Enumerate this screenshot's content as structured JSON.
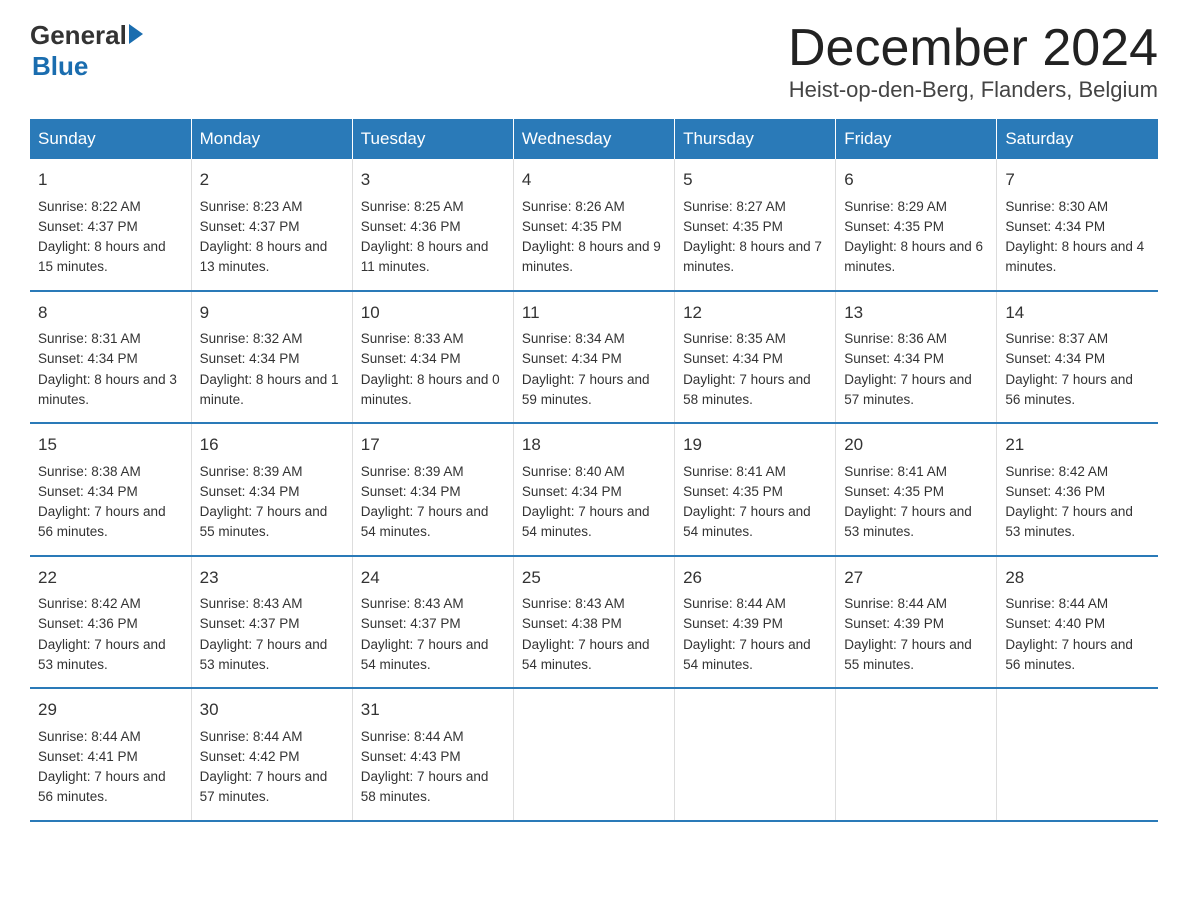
{
  "header": {
    "logo_general": "General",
    "logo_blue": "Blue",
    "month": "December 2024",
    "location": "Heist-op-den-Berg, Flanders, Belgium"
  },
  "weekdays": [
    "Sunday",
    "Monday",
    "Tuesday",
    "Wednesday",
    "Thursday",
    "Friday",
    "Saturday"
  ],
  "weeks": [
    [
      {
        "day": "1",
        "sunrise": "8:22 AM",
        "sunset": "4:37 PM",
        "daylight": "8 hours and 15 minutes."
      },
      {
        "day": "2",
        "sunrise": "8:23 AM",
        "sunset": "4:37 PM",
        "daylight": "8 hours and 13 minutes."
      },
      {
        "day": "3",
        "sunrise": "8:25 AM",
        "sunset": "4:36 PM",
        "daylight": "8 hours and 11 minutes."
      },
      {
        "day": "4",
        "sunrise": "8:26 AM",
        "sunset": "4:35 PM",
        "daylight": "8 hours and 9 minutes."
      },
      {
        "day": "5",
        "sunrise": "8:27 AM",
        "sunset": "4:35 PM",
        "daylight": "8 hours and 7 minutes."
      },
      {
        "day": "6",
        "sunrise": "8:29 AM",
        "sunset": "4:35 PM",
        "daylight": "8 hours and 6 minutes."
      },
      {
        "day": "7",
        "sunrise": "8:30 AM",
        "sunset": "4:34 PM",
        "daylight": "8 hours and 4 minutes."
      }
    ],
    [
      {
        "day": "8",
        "sunrise": "8:31 AM",
        "sunset": "4:34 PM",
        "daylight": "8 hours and 3 minutes."
      },
      {
        "day": "9",
        "sunrise": "8:32 AM",
        "sunset": "4:34 PM",
        "daylight": "8 hours and 1 minute."
      },
      {
        "day": "10",
        "sunrise": "8:33 AM",
        "sunset": "4:34 PM",
        "daylight": "8 hours and 0 minutes."
      },
      {
        "day": "11",
        "sunrise": "8:34 AM",
        "sunset": "4:34 PM",
        "daylight": "7 hours and 59 minutes."
      },
      {
        "day": "12",
        "sunrise": "8:35 AM",
        "sunset": "4:34 PM",
        "daylight": "7 hours and 58 minutes."
      },
      {
        "day": "13",
        "sunrise": "8:36 AM",
        "sunset": "4:34 PM",
        "daylight": "7 hours and 57 minutes."
      },
      {
        "day": "14",
        "sunrise": "8:37 AM",
        "sunset": "4:34 PM",
        "daylight": "7 hours and 56 minutes."
      }
    ],
    [
      {
        "day": "15",
        "sunrise": "8:38 AM",
        "sunset": "4:34 PM",
        "daylight": "7 hours and 56 minutes."
      },
      {
        "day": "16",
        "sunrise": "8:39 AM",
        "sunset": "4:34 PM",
        "daylight": "7 hours and 55 minutes."
      },
      {
        "day": "17",
        "sunrise": "8:39 AM",
        "sunset": "4:34 PM",
        "daylight": "7 hours and 54 minutes."
      },
      {
        "day": "18",
        "sunrise": "8:40 AM",
        "sunset": "4:34 PM",
        "daylight": "7 hours and 54 minutes."
      },
      {
        "day": "19",
        "sunrise": "8:41 AM",
        "sunset": "4:35 PM",
        "daylight": "7 hours and 54 minutes."
      },
      {
        "day": "20",
        "sunrise": "8:41 AM",
        "sunset": "4:35 PM",
        "daylight": "7 hours and 53 minutes."
      },
      {
        "day": "21",
        "sunrise": "8:42 AM",
        "sunset": "4:36 PM",
        "daylight": "7 hours and 53 minutes."
      }
    ],
    [
      {
        "day": "22",
        "sunrise": "8:42 AM",
        "sunset": "4:36 PM",
        "daylight": "7 hours and 53 minutes."
      },
      {
        "day": "23",
        "sunrise": "8:43 AM",
        "sunset": "4:37 PM",
        "daylight": "7 hours and 53 minutes."
      },
      {
        "day": "24",
        "sunrise": "8:43 AM",
        "sunset": "4:37 PM",
        "daylight": "7 hours and 54 minutes."
      },
      {
        "day": "25",
        "sunrise": "8:43 AM",
        "sunset": "4:38 PM",
        "daylight": "7 hours and 54 minutes."
      },
      {
        "day": "26",
        "sunrise": "8:44 AM",
        "sunset": "4:39 PM",
        "daylight": "7 hours and 54 minutes."
      },
      {
        "day": "27",
        "sunrise": "8:44 AM",
        "sunset": "4:39 PM",
        "daylight": "7 hours and 55 minutes."
      },
      {
        "day": "28",
        "sunrise": "8:44 AM",
        "sunset": "4:40 PM",
        "daylight": "7 hours and 56 minutes."
      }
    ],
    [
      {
        "day": "29",
        "sunrise": "8:44 AM",
        "sunset": "4:41 PM",
        "daylight": "7 hours and 56 minutes."
      },
      {
        "day": "30",
        "sunrise": "8:44 AM",
        "sunset": "4:42 PM",
        "daylight": "7 hours and 57 minutes."
      },
      {
        "day": "31",
        "sunrise": "8:44 AM",
        "sunset": "4:43 PM",
        "daylight": "7 hours and 58 minutes."
      },
      null,
      null,
      null,
      null
    ]
  ],
  "labels": {
    "sunrise": "Sunrise:",
    "sunset": "Sunset:",
    "daylight": "Daylight:"
  }
}
